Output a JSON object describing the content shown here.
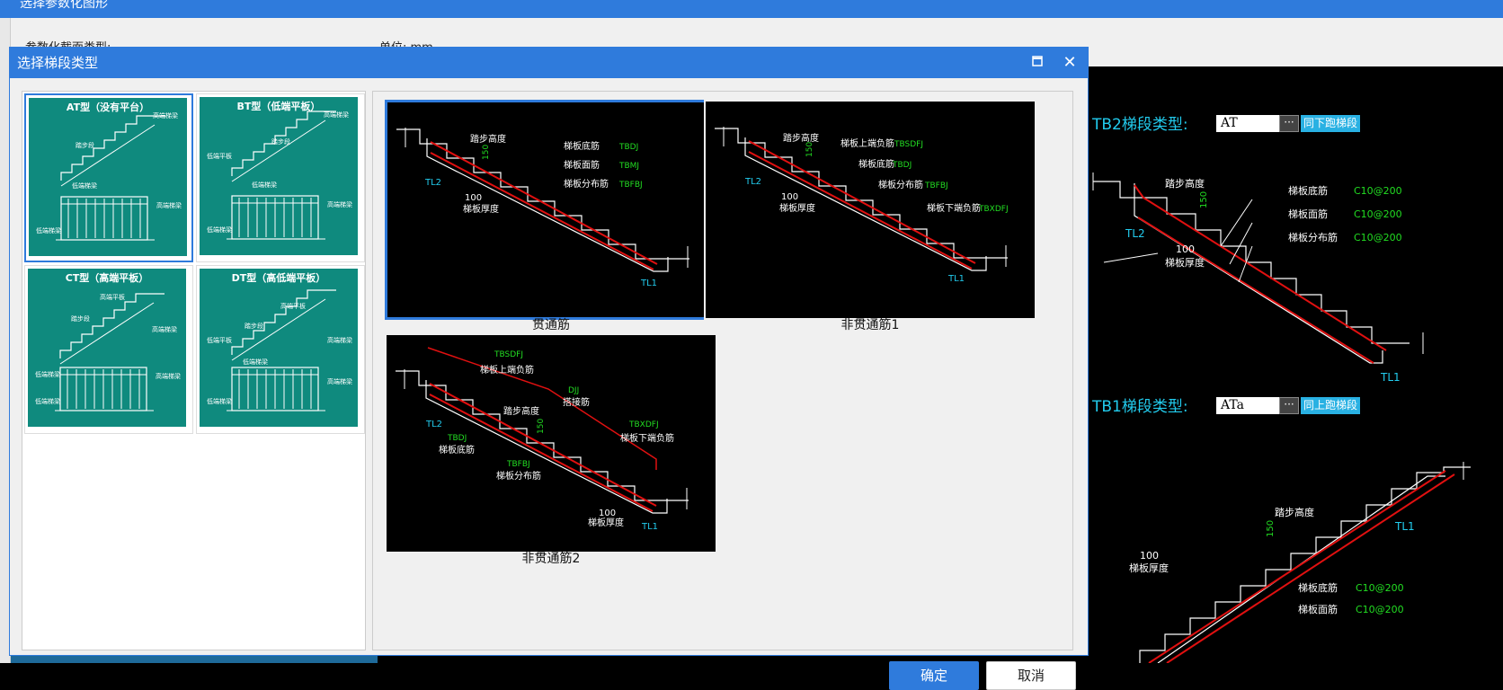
{
  "background": {
    "title": "选择参数化图形",
    "section_type_label": "参数化截面类型:",
    "unit_label": "单位: mm"
  },
  "dialog": {
    "title": "选择梯段类型",
    "maximize_icon": "maximize-icon",
    "close_icon": "close-icon",
    "ok_label": "确定",
    "cancel_label": "取消"
  },
  "stair_types": [
    {
      "title": "AT型（没有平台）",
      "labels": [
        "高端梯梁",
        "踏步段",
        "低端梯梁",
        "高端梯梁",
        "低端梯梁"
      ],
      "selected": true
    },
    {
      "title": "BT型（低端平板）",
      "labels": [
        "高端梯梁",
        "踏步段",
        "低端平板",
        "低端梯梁",
        "高端梯梁",
        "低端梯梁"
      ],
      "selected": false
    },
    {
      "title": "CT型（高端平板）",
      "labels": [
        "高端平板",
        "踏步段",
        "高端梯梁",
        "低端梯梁",
        "高端梯梁",
        "低端梯梁"
      ],
      "selected": false
    },
    {
      "title": "DT型（高低端平板）",
      "labels": [
        "高端平板",
        "踏步段",
        "低端平板",
        "高端梯梁",
        "低端梯梁",
        "高端梯梁",
        "低端梯梁"
      ],
      "selected": false
    }
  ],
  "rebar_options": [
    {
      "caption": "贯通筋",
      "selected": true,
      "white": [
        "踏步高度",
        "梯板底筋",
        "梯板面筋",
        "梯板分布筋",
        "100",
        "梯板厚度"
      ],
      "green": [
        "150",
        "TBDJ",
        "TBMJ",
        "TBFBJ"
      ],
      "cyan": [
        "TL2",
        "TL1"
      ]
    },
    {
      "caption": "非贯通筋1",
      "selected": false,
      "white": [
        "踏步高度",
        "梯板上端负筋",
        "梯板底筋",
        "梯板分布筋",
        "梯板下端负筋",
        "100",
        "梯板厚度"
      ],
      "green": [
        "150",
        "TBSDFJ",
        "TBDJ",
        "TBFBJ",
        "TBXDFJ"
      ],
      "cyan": [
        "TL2",
        "TL1"
      ]
    },
    {
      "caption": "非贯通筋2",
      "selected": false,
      "white": [
        "梯板上端负筋",
        "搭接筋",
        "踏步高度",
        "梯板底筋",
        "梯板下端负筋",
        "梯板分布筋",
        "100",
        "梯板厚度"
      ],
      "green": [
        "TBSDFJ",
        "DJJ",
        "150",
        "TBDJ",
        "TBXDFJ",
        "TBFBJ"
      ],
      "cyan": [
        "TL2",
        "TL1"
      ]
    }
  ],
  "right_panel": {
    "tb2": {
      "label": "TB2梯段类型:",
      "value": "AT",
      "button": "同下跑梯段",
      "white": [
        "踏步高度",
        "梯板底筋",
        "梯板面筋",
        "梯板分布筋",
        "100",
        "梯板厚度"
      ],
      "green": [
        "150",
        "C10@200",
        "C10@200",
        "C10@200"
      ],
      "cyan": [
        "TL2",
        "TL1"
      ]
    },
    "tb1": {
      "label": "TB1梯段类型:",
      "value": "ATa",
      "button": "同上跑梯段",
      "white": [
        "踏步高度",
        "100",
        "梯板厚度",
        "梯板底筋",
        "梯板面筋"
      ],
      "green": [
        "150",
        "C10@200",
        "C10@200"
      ],
      "cyan": [
        "TL1"
      ]
    }
  },
  "colors": {
    "title_blue": "#2f7bdc",
    "teal": "#0f8a7e",
    "rebar_red": "#e01010",
    "label_green": "#22dd22",
    "label_cyan": "#22ccee"
  }
}
